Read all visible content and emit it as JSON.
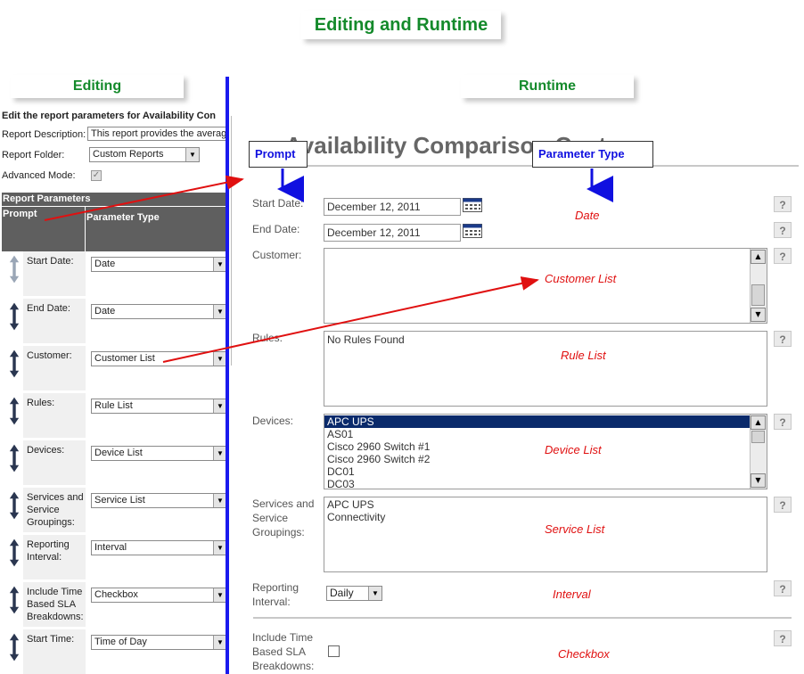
{
  "header": {
    "main_title": "Editing and Runtime",
    "editing_title": "Editing",
    "runtime_title": "Runtime"
  },
  "editing": {
    "section_title": "Edit the report parameters for Availability Con",
    "report_description_label": "Report Description:",
    "report_description_value": "This report provides the averag",
    "report_folder_label": "Report Folder:",
    "report_folder_value": "Custom Reports",
    "advanced_mode_label": "Advanced Mode:",
    "report_parameters_header": "Report Parameters",
    "col_prompt": "Prompt",
    "col_parameter_type": "Parameter Type",
    "params": [
      {
        "prompt": "Start Date:",
        "type": "Date"
      },
      {
        "prompt": "End Date:",
        "type": "Date"
      },
      {
        "prompt": "Customer:",
        "type": "Customer List"
      },
      {
        "prompt": "Rules:",
        "type": "Rule List"
      },
      {
        "prompt": "Devices:",
        "type": "Device List"
      },
      {
        "prompt": "Services and Service Groupings:",
        "type": "Service List"
      },
      {
        "prompt": "Reporting Interval:",
        "type": "Interval"
      },
      {
        "prompt": "Include Time Based SLA Breakdowns:",
        "type": "Checkbox"
      },
      {
        "prompt": "Start Time:",
        "type": "Time of Day"
      }
    ]
  },
  "runtime": {
    "report_title": "Availability Comparison Cost",
    "callout_prompt": "Prompt",
    "callout_param_type": "Parameter Type",
    "start_date_label": "Start Date:",
    "start_date_value": "December 12, 2011",
    "end_date_label": "End Date:",
    "end_date_value": "December 12, 2011",
    "customer_label": "Customer:",
    "rules_label": "Rules:",
    "rules_value": "No Rules Found",
    "devices_label": "Devices:",
    "devices": [
      "APC UPS",
      "AS01",
      "Cisco 2960 Switch #1",
      "Cisco 2960 Switch #2",
      "DC01",
      "DC03"
    ],
    "services_label": "Services and Service Groupings:",
    "services": [
      "APC UPS",
      "Connectivity"
    ],
    "interval_label": "Reporting Interval:",
    "interval_value": "Daily",
    "sla_label": "Include Time Based SLA Breakdowns:",
    "help_glyph": "?",
    "annotations": {
      "date": "Date",
      "customer_list": "Customer List",
      "rule_list": "Rule List",
      "device_list": "Device List",
      "service_list": "Service List",
      "interval": "Interval",
      "checkbox": "Checkbox"
    }
  },
  "colors": {
    "title_green": "#148a2b",
    "callout_blue": "#1010e0",
    "annotation_red": "#e01010",
    "divider_blue": "#1a1aee",
    "table_header": "#5f5f5f"
  },
  "icons": [
    "calendar-icon",
    "up-down-arrow-icon",
    "dropdown-arrow-icon",
    "help-icon",
    "scroll-arrow-icon"
  ]
}
